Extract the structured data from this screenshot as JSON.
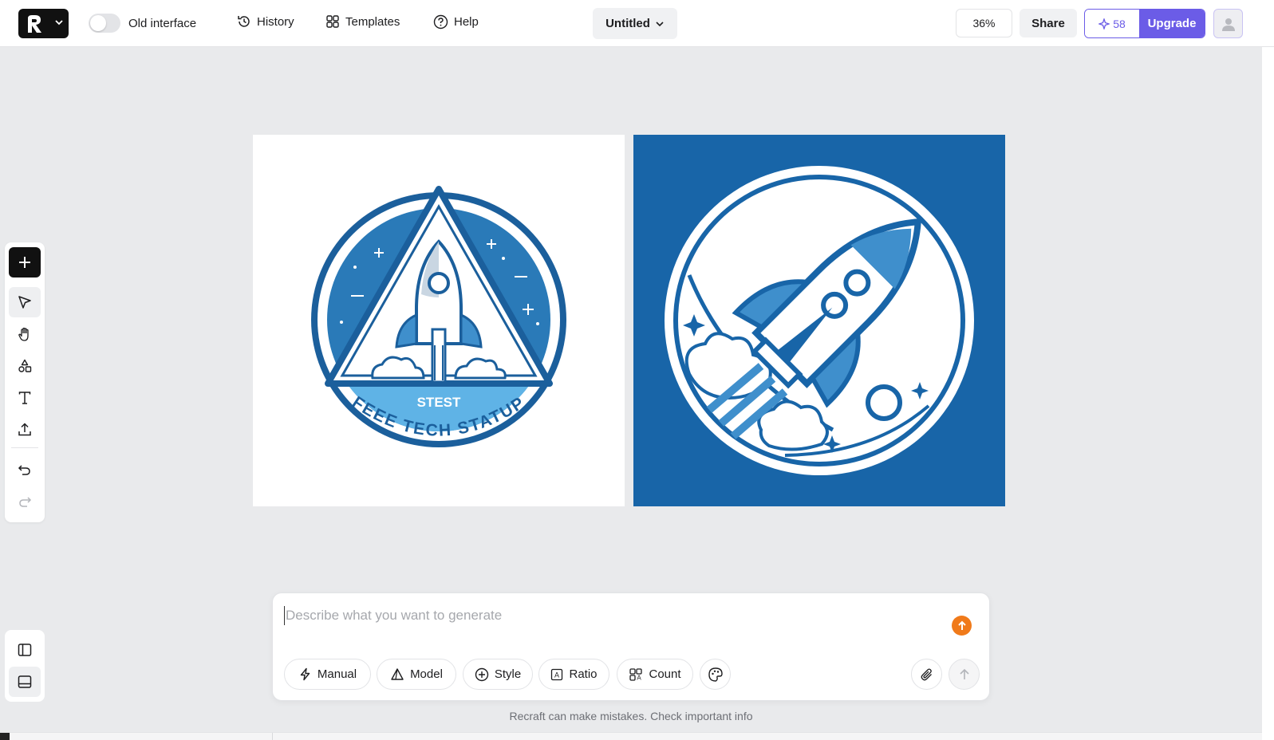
{
  "topbar": {
    "logo_icon": "recraft-logo-icon",
    "toggle_label": "Old interface",
    "history_label": "History",
    "templates_label": "Templates",
    "help_label": "Help",
    "project_title": "Untitled",
    "zoom": "36%",
    "share_label": "Share",
    "credits": "58",
    "upgrade_label": "Upgrade"
  },
  "toolbar": {
    "tools": [
      "add-icon",
      "select-icon",
      "hand-icon",
      "shapes-icon",
      "text-icon",
      "upload-icon",
      "undo-icon",
      "redo-icon"
    ]
  },
  "canvas": {
    "image1": {
      "top_text": "STEST",
      "arc_text": "FEEE TECH STATUP",
      "color": "#1b5f9c"
    },
    "image2": {
      "background": "#1865a8"
    }
  },
  "prompt": {
    "placeholder": "Describe what you want to generate",
    "value": "",
    "buttons": {
      "manual": "Manual",
      "model": "Model",
      "style": "Style",
      "ratio": "Ratio",
      "count": "Count"
    }
  },
  "disclaimer": "Recraft can make mistakes. Check important info",
  "colors": {
    "accent": "#6b5ce7",
    "orange": "#f07a1a",
    "blue": "#1865a8"
  }
}
